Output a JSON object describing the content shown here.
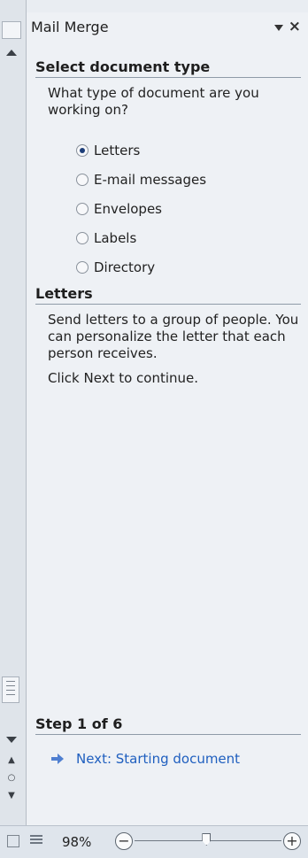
{
  "pane": {
    "title": "Mail Merge",
    "menu_icon": "chevron-down-icon",
    "close_icon": "close-icon"
  },
  "select_type": {
    "heading": "Select document type",
    "question": "What type of document are you working on?",
    "options": [
      {
        "label": "Letters",
        "selected": true
      },
      {
        "label": "E-mail messages",
        "selected": false
      },
      {
        "label": "Envelopes",
        "selected": false
      },
      {
        "label": "Labels",
        "selected": false
      },
      {
        "label": "Directory",
        "selected": false
      }
    ]
  },
  "letters": {
    "heading": "Letters",
    "description": "Send letters to a group of people. You can personalize the letter that each person receives.",
    "instruction": "Click Next to continue."
  },
  "step": {
    "heading": "Step 1 of 6",
    "next_label": "Next: Starting document"
  },
  "statusbar": {
    "zoom_value": "98%",
    "zoom_minus": "−",
    "zoom_plus": "+",
    "zoom_fraction": 0.49
  },
  "colors": {
    "link": "#1f5fbf",
    "pane_bg": "#eef1f5"
  }
}
